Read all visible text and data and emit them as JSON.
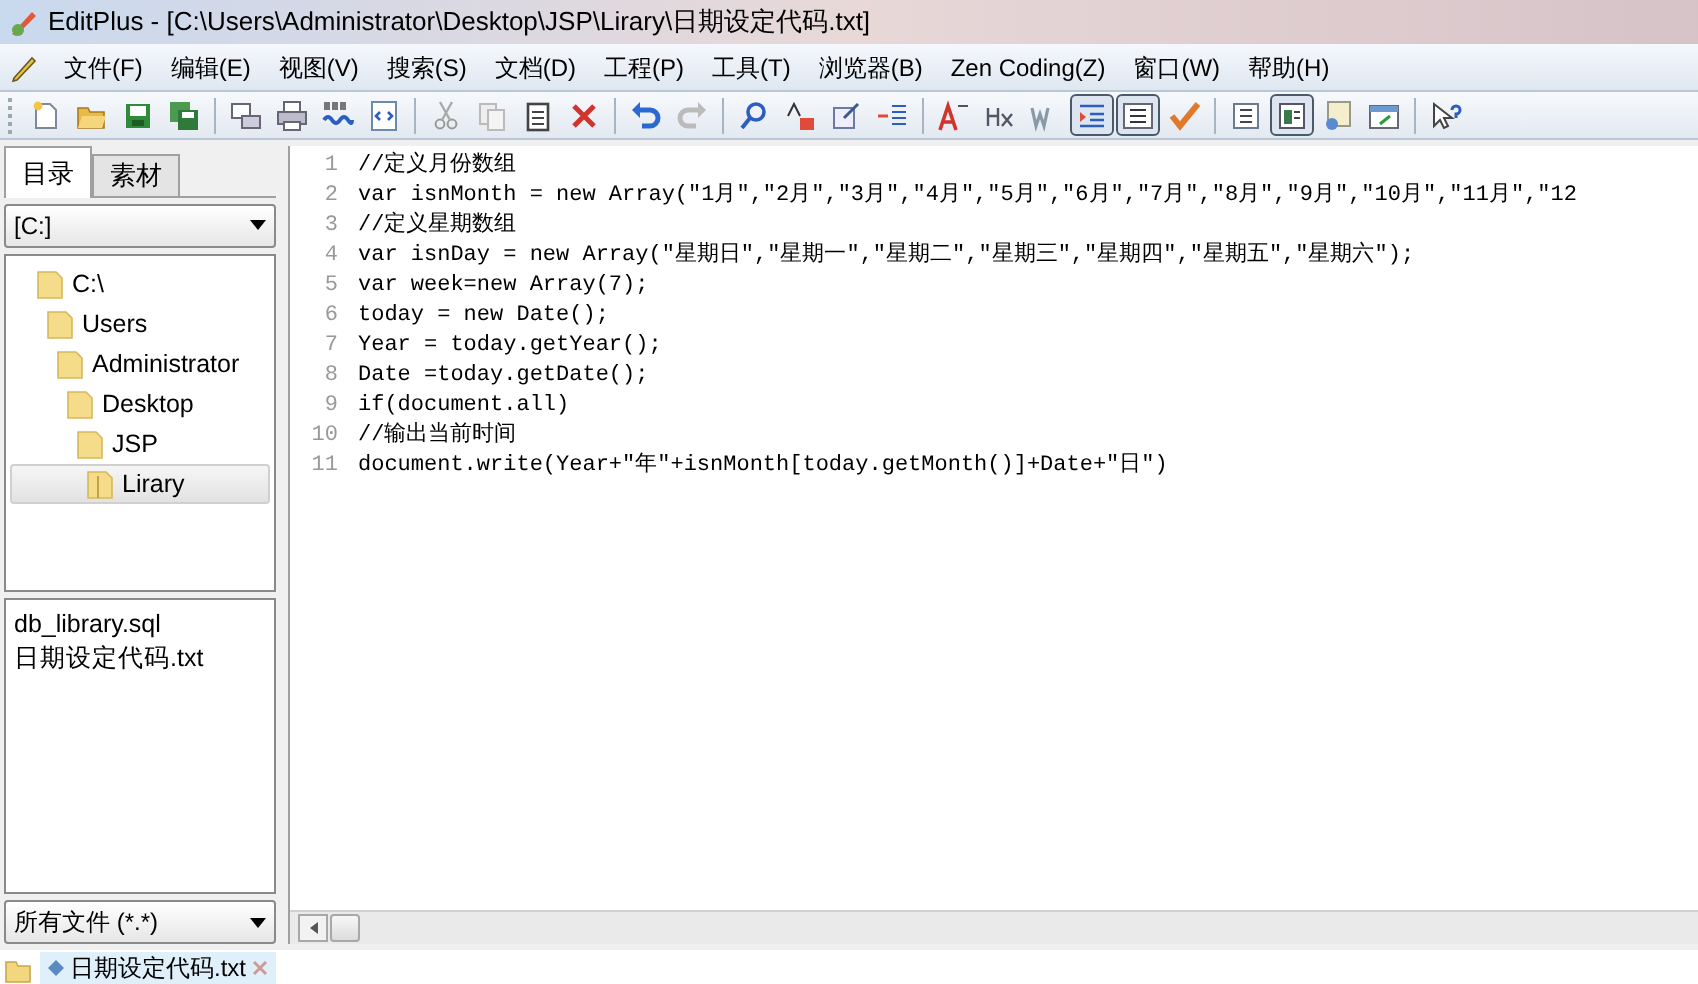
{
  "window": {
    "title": "EditPlus - [C:\\Users\\Administrator\\Desktop\\JSP\\Lirary\\日期设定代码.txt]"
  },
  "menu": [
    "文件(F)",
    "编辑(E)",
    "视图(V)",
    "搜索(S)",
    "文档(D)",
    "工程(P)",
    "工具(T)",
    "浏览器(B)",
    "Zen Coding(Z)",
    "窗口(W)",
    "帮助(H)"
  ],
  "toolbar": [
    {
      "pressed": false
    },
    {
      "pressed": false
    },
    {
      "pressed": false
    },
    {
      "pressed": false
    },
    {
      "pressed": false
    },
    {
      "pressed": false
    },
    {
      "pressed": false
    },
    {
      "pressed": false
    },
    {
      "pressed": false
    },
    {
      "pressed": false
    },
    {
      "pressed": false
    },
    {
      "pressed": false
    },
    {
      "pressed": false
    },
    {
      "pressed": false
    },
    {
      "pressed": false
    },
    {
      "pressed": false
    },
    {
      "pressed": false
    },
    {
      "pressed": false
    },
    {
      "pressed": false
    },
    {
      "pressed": false
    },
    {
      "pressed": false
    },
    {
      "pressed": true
    },
    {
      "pressed": true
    },
    {
      "pressed": false
    },
    {
      "pressed": false
    },
    {
      "pressed": true
    },
    {
      "pressed": false
    },
    {
      "pressed": false
    },
    {
      "pressed": false
    }
  ],
  "sidebar": {
    "tabs": [
      {
        "label": "目录",
        "selected": true
      },
      {
        "label": "素材",
        "selected": false
      }
    ],
    "drive": "[C:]",
    "tree": [
      {
        "label": "C:\\",
        "selected": false,
        "children": [
          {
            "label": "Users",
            "selected": false,
            "children": [
              {
                "label": "Administrator",
                "selected": false,
                "children": [
                  {
                    "label": "Desktop",
                    "selected": false,
                    "children": [
                      {
                        "label": "JSP",
                        "selected": false,
                        "children": [
                          {
                            "label": "Lirary",
                            "selected": true
                          }
                        ]
                      }
                    ]
                  }
                ]
              }
            ]
          }
        ]
      }
    ],
    "files": [
      "db_library.sql",
      "日期设定代码.txt"
    ],
    "filter": "所有文件 (*.*)"
  },
  "editor": {
    "lines": [
      {
        "number": "1",
        "text": "//定义月份数组"
      },
      {
        "number": "2",
        "text": "var isnMonth = new Array(\"1月\",\"2月\",\"3月\",\"4月\",\"5月\",\"6月\",\"7月\",\"8月\",\"9月\",\"10月\",\"11月\",\"12"
      },
      {
        "number": "3",
        "text": "//定义星期数组"
      },
      {
        "number": "4",
        "text": "var isnDay = new Array(\"星期日\",\"星期一\",\"星期二\",\"星期三\",\"星期四\",\"星期五\",\"星期六\");"
      },
      {
        "number": "5",
        "text": "var week=new Array(7);"
      },
      {
        "number": "6",
        "text": "today = new Date();"
      },
      {
        "number": "7",
        "text": "Year = today.getYear();"
      },
      {
        "number": "8",
        "text": "Date =today.getDate();"
      },
      {
        "number": "9",
        "text": "if(document.all)"
      },
      {
        "number": "10",
        "text": "//输出当前时间"
      },
      {
        "number": "11",
        "text": "document.write(Year+\"年\"+isnMonth[today.getMonth()]+Date+\"日\")"
      }
    ]
  },
  "document_tabs": [
    {
      "label": "日期设定代码.txt",
      "selected": true
    }
  ]
}
